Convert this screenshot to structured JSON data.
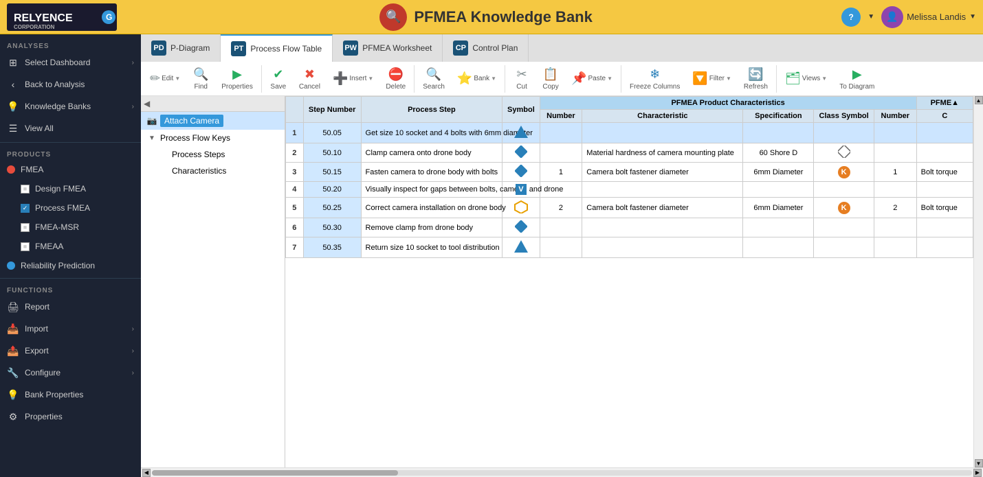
{
  "app": {
    "logo_text": "RELYENCE CORPORATION",
    "header_title": "PFMEA Knowledge Bank",
    "user_name": "Melissa Landis",
    "help_icon": "?",
    "header_icon": "🔍"
  },
  "tabs": [
    {
      "badge": "PD",
      "label": "P-Diagram",
      "active": false
    },
    {
      "badge": "PT",
      "label": "Process Flow Table",
      "active": true
    },
    {
      "badge": "PW",
      "label": "PFMEA Worksheet",
      "active": false
    },
    {
      "badge": "CP",
      "label": "Control Plan",
      "active": false
    }
  ],
  "toolbar": {
    "buttons": [
      {
        "id": "edit",
        "label": "Edit",
        "icon": "✏️",
        "color": "gray",
        "dropdown": true
      },
      {
        "id": "find",
        "label": "Find",
        "icon": "🔍",
        "color": "gray"
      },
      {
        "id": "properties",
        "label": "Properties",
        "icon": "▶",
        "color": "green"
      },
      {
        "id": "save",
        "label": "Save",
        "icon": "✔",
        "color": "green"
      },
      {
        "id": "cancel",
        "label": "Cancel",
        "icon": "✖",
        "color": "red"
      },
      {
        "id": "insert",
        "label": "Insert",
        "icon": "➕",
        "color": "green",
        "dropdown": true
      },
      {
        "id": "delete",
        "label": "Delete",
        "icon": "⛔",
        "color": "red"
      },
      {
        "id": "search",
        "label": "Search",
        "icon": "🔍",
        "color": "gray"
      },
      {
        "id": "bank",
        "label": "Bank",
        "icon": "⭐",
        "color": "orange",
        "dropdown": true
      },
      {
        "id": "cut",
        "label": "Cut",
        "icon": "✂",
        "color": "gray"
      },
      {
        "id": "copy",
        "label": "Copy",
        "icon": "📋",
        "color": "gray"
      },
      {
        "id": "paste",
        "label": "Paste",
        "icon": "📌",
        "color": "gray",
        "dropdown": true
      },
      {
        "id": "freeze",
        "label": "Freeze Columns",
        "icon": "❄",
        "color": "blue"
      },
      {
        "id": "filter",
        "label": "Filter",
        "icon": "🔽",
        "color": "teal",
        "dropdown": true
      },
      {
        "id": "refresh",
        "label": "Refresh",
        "icon": "🔄",
        "color": "blue"
      },
      {
        "id": "views",
        "label": "Views",
        "icon": "🗂",
        "color": "green",
        "dropdown": true
      },
      {
        "id": "to-diagram",
        "label": "To Diagram",
        "icon": "▶",
        "color": "green"
      }
    ]
  },
  "sidebar": {
    "analyses_section": "ANALYSES",
    "select_dashboard": "Select Dashboard",
    "back_to_analysis": "Back to Analysis",
    "knowledge_banks": "Knowledge Banks",
    "view_all": "View All",
    "products_section": "PRODUCTS",
    "fmea": "FMEA",
    "design_fmea": "Design FMEA",
    "process_fmea": "Process FMEA",
    "fmea_msr": "FMEA-MSR",
    "fmea_a": "FMEA​A",
    "reliability_prediction": "Reliability Prediction",
    "functions_section": "FUNCTIONS",
    "report": "Report",
    "import": "Import",
    "export": "Export",
    "configure": "Configure",
    "bank_properties": "Bank Properties",
    "properties": "Properties"
  },
  "tree": {
    "items": [
      {
        "id": "attach-camera",
        "label": "Attach Camera",
        "level": 0,
        "type": "highlight",
        "indent": 10
      },
      {
        "id": "process-flow-keys",
        "label": "Process Flow Keys",
        "level": 0,
        "type": "toggle",
        "indent": 10
      },
      {
        "id": "process-steps",
        "label": "Process Steps",
        "level": 1,
        "type": "normal",
        "indent": 30
      },
      {
        "id": "characteristics",
        "label": "Characteristics",
        "level": 1,
        "type": "normal",
        "indent": 30
      }
    ]
  },
  "table": {
    "col_group_pfmea": "PFMEA Product Characteristics",
    "col_group_pfmea2": "PFME",
    "columns": [
      {
        "id": "row-num",
        "label": ""
      },
      {
        "id": "step-number",
        "label": "Step Number"
      },
      {
        "id": "process-step",
        "label": "Process Step"
      },
      {
        "id": "symbol",
        "label": "Symbol"
      },
      {
        "id": "number",
        "label": "Number"
      },
      {
        "id": "characteristic",
        "label": "Characteristic"
      },
      {
        "id": "specification",
        "label": "Specification"
      },
      {
        "id": "class-symbol",
        "label": "Class Symbol"
      },
      {
        "id": "pfmea-number",
        "label": "Number"
      },
      {
        "id": "c",
        "label": "C"
      }
    ],
    "rows": [
      {
        "row_num": 1,
        "step_number": "50.05",
        "process_step": "Get size 10 socket and 4 bolts with 6mm diameter",
        "symbol": "triangle",
        "number": "",
        "characteristic": "",
        "specification": "",
        "class_symbol": "",
        "pfmea_number": "",
        "c": "",
        "selected": true
      },
      {
        "row_num": 2,
        "step_number": "50.10",
        "process_step": "Clamp camera onto drone body",
        "symbol": "diamond",
        "number": "",
        "characteristic": "Material hardness of camera mounting plate",
        "specification": "60 Shore D",
        "class_symbol": "diamond-empty",
        "pfmea_number": "",
        "c": "",
        "selected": false
      },
      {
        "row_num": 3,
        "step_number": "50.15",
        "process_step": "Fasten camera to drone body with bolts",
        "symbol": "diamond",
        "number": "1",
        "characteristic": "Camera bolt fastener diameter",
        "specification": "6mm Diameter",
        "class_symbol": "k-orange",
        "pfmea_number": "1",
        "c": "Bolt torque",
        "selected": false
      },
      {
        "row_num": 4,
        "step_number": "50.20",
        "process_step": "Visually inspect for gaps between bolts, camera, and drone",
        "symbol": "v-square",
        "number": "",
        "characteristic": "",
        "specification": "",
        "class_symbol": "",
        "pfmea_number": "",
        "c": "",
        "selected": false
      },
      {
        "row_num": 5,
        "step_number": "50.25",
        "process_step": "Correct camera installation on drone body",
        "symbol": "pentagon",
        "number": "2",
        "characteristic": "Camera bolt fastener diameter",
        "specification": "6mm Diameter",
        "class_symbol": "k-orange",
        "pfmea_number": "2",
        "c": "Bolt torque",
        "selected": false
      },
      {
        "row_num": 6,
        "step_number": "50.30",
        "process_step": "Remove clamp from drone body",
        "symbol": "diamond",
        "number": "",
        "characteristic": "",
        "specification": "",
        "class_symbol": "",
        "pfmea_number": "",
        "c": "",
        "selected": false
      },
      {
        "row_num": 7,
        "step_number": "50.35",
        "process_step": "Return size 10 socket to tool distribution",
        "symbol": "triangle",
        "number": "",
        "characteristic": "",
        "specification": "",
        "class_symbol": "",
        "pfmea_number": "",
        "c": "",
        "selected": false
      }
    ]
  }
}
